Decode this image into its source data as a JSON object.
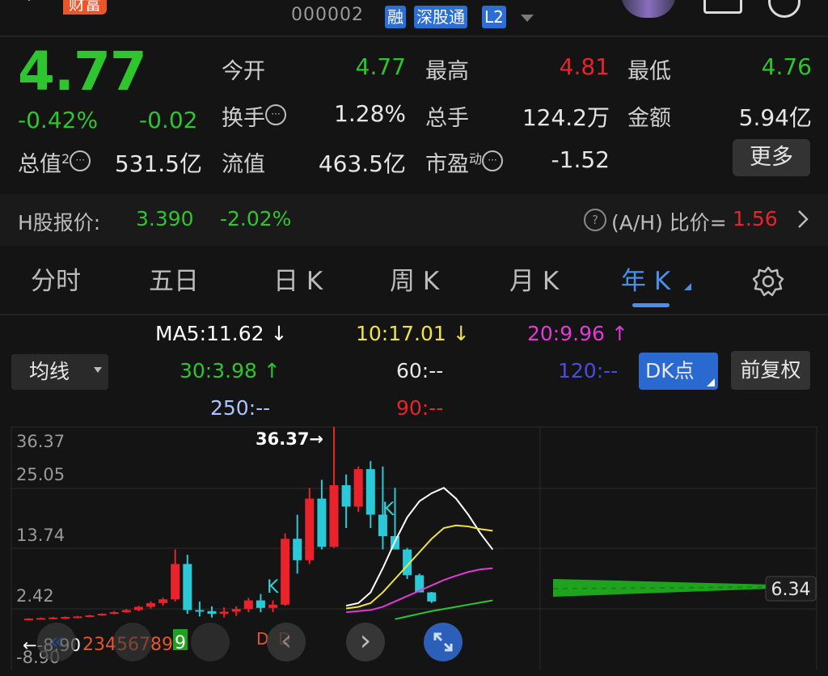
{
  "header": {
    "badge": "财富",
    "code": "000002",
    "tags": [
      "融",
      "深股通",
      "L2"
    ]
  },
  "quote": {
    "price": "4.77",
    "change_pct": "-0.42%",
    "change": "-0.02",
    "open_label": "今开",
    "open": "4.77",
    "high_label": "最高",
    "high": "4.81",
    "low_label": "最低",
    "low": "4.76",
    "turnover_label": "换手",
    "turnover": "1.28%",
    "volume_label": "总手",
    "volume": "124.2万",
    "amount_label": "金额",
    "amount": "5.94亿",
    "mktcap_label": "总值",
    "mktcap_sup": "2",
    "mktcap": "531.5亿",
    "float_label": "流值",
    "float": "463.5亿",
    "pe_label": "市盈",
    "pe_sup": "动",
    "pe": "-1.52",
    "more_label": "更多"
  },
  "hshare": {
    "label": "H股报价:",
    "price": "3.390",
    "change_pct": "-2.02%",
    "ratio_label": "(A/H) 比价=",
    "ratio": "1.56"
  },
  "tabs": [
    "分时",
    "五日",
    "日 K",
    "周 K",
    "月 K",
    "年 K"
  ],
  "active_tab_index": 5,
  "ma": {
    "ma5": "MA5:11.62 ↓",
    "ma10": "10:17.01 ↓",
    "ma20": "20:9.96 ↑",
    "ma30": "30:3.98 ↑",
    "ma60": "60:--",
    "ma120": "120:--",
    "ma250": "250:--",
    "ma90": "90:--",
    "line_select": "均线",
    "dk_label": "DK点",
    "fq_label": "前复权"
  },
  "chart_data": {
    "type": "candlestick",
    "y_tick_labels": [
      "36.37",
      "25.05",
      "13.74",
      "2.42",
      "-8.90"
    ],
    "max_marker": "36.37→",
    "min_marker": "←-8.90",
    "last_value_label": "6.34",
    "signal_labels": [
      "K",
      "K",
      "D",
      "D"
    ],
    "count_label": "23456789",
    "count_highlight": "9",
    "candles": [
      {
        "o": 0.5,
        "h": 0.7,
        "l": 0.4,
        "c": 0.6
      },
      {
        "o": 0.6,
        "h": 0.8,
        "l": 0.5,
        "c": 0.7
      },
      {
        "o": 0.7,
        "h": 0.9,
        "l": 0.6,
        "c": 0.8
      },
      {
        "o": 0.8,
        "h": 1.0,
        "l": 0.7,
        "c": 0.9
      },
      {
        "o": 0.9,
        "h": 1.1,
        "l": 0.8,
        "c": 1.0
      },
      {
        "o": 1.0,
        "h": 1.3,
        "l": 0.9,
        "c": 1.2
      },
      {
        "o": 1.2,
        "h": 1.6,
        "l": 1.1,
        "c": 1.5
      },
      {
        "o": 1.5,
        "h": 2.0,
        "l": 1.4,
        "c": 1.8
      },
      {
        "o": 1.8,
        "h": 2.4,
        "l": 1.7,
        "c": 2.2
      },
      {
        "o": 2.2,
        "h": 3.0,
        "l": 2.0,
        "c": 2.8
      },
      {
        "o": 2.8,
        "h": 3.8,
        "l": 2.5,
        "c": 3.5
      },
      {
        "o": 3.5,
        "h": 4.5,
        "l": 3.0,
        "c": 4.2
      },
      {
        "o": 4.2,
        "h": 13.5,
        "l": 3.8,
        "c": 10.8
      },
      {
        "o": 10.8,
        "h": 12.5,
        "l": 1.5,
        "c": 2.2
      },
      {
        "o": 2.2,
        "h": 3.8,
        "l": 1.0,
        "c": 2.0
      },
      {
        "o": 2.0,
        "h": 2.9,
        "l": 0.8,
        "c": 1.5
      },
      {
        "o": 1.5,
        "h": 2.7,
        "l": 0.8,
        "c": 1.9
      },
      {
        "o": 1.9,
        "h": 2.9,
        "l": 1.1,
        "c": 2.4
      },
      {
        "o": 2.4,
        "h": 4.5,
        "l": 1.8,
        "c": 4.0
      },
      {
        "o": 4.0,
        "h": 5.2,
        "l": 1.8,
        "c": 2.6
      },
      {
        "o": 2.6,
        "h": 4.0,
        "l": 1.8,
        "c": 3.2
      },
      {
        "o": 3.2,
        "h": 16.5,
        "l": 3.0,
        "c": 15.5
      },
      {
        "o": 15.5,
        "h": 20.0,
        "l": 9.0,
        "c": 11.5
      },
      {
        "o": 11.5,
        "h": 25.0,
        "l": 10.8,
        "c": 23.0
      },
      {
        "o": 23.0,
        "h": 26.5,
        "l": 13.5,
        "c": 14.0
      },
      {
        "o": 14.0,
        "h": 36.37,
        "l": 13.8,
        "c": 25.5
      },
      {
        "o": 25.5,
        "h": 27.5,
        "l": 17.5,
        "c": 21.5
      },
      {
        "o": 21.5,
        "h": 29.0,
        "l": 20.5,
        "c": 28.5
      },
      {
        "o": 28.5,
        "h": 30.0,
        "l": 17.5,
        "c": 20.0
      },
      {
        "o": 20.0,
        "h": 29.0,
        "l": 13.5,
        "c": 16.0
      },
      {
        "o": 16.0,
        "h": 25.0,
        "l": 13.5,
        "c": 13.5
      },
      {
        "o": 13.5,
        "h": 13.8,
        "l": 8.0,
        "c": 8.7
      },
      {
        "o": 8.7,
        "h": 9.0,
        "l": 5.5,
        "c": 5.5
      },
      {
        "o": 5.5,
        "h": 5.6,
        "l": 3.5,
        "c": 3.8
      }
    ],
    "ma_lines": {
      "ma5": {
        "color": "#ffffff",
        "start": 26,
        "values": [
          3.0,
          3.5,
          5.5,
          10.0,
          15.0,
          19.5,
          22.5,
          24.0,
          25.0,
          23.0,
          20.0,
          16.5,
          13.5
        ]
      },
      "ma10": {
        "color": "#f0e442",
        "start": 26,
        "values": [
          2.5,
          2.8,
          3.5,
          5.5,
          8.0,
          10.5,
          13.0,
          15.5,
          17.5,
          18.0,
          17.8,
          17.3,
          17.0
        ]
      },
      "ma20": {
        "color": "#e03ad8",
        "start": 26,
        "values": [
          1.8,
          2.0,
          2.2,
          2.8,
          3.8,
          4.8,
          5.8,
          6.8,
          7.8,
          8.6,
          9.3,
          9.8,
          10.0
        ]
      },
      "ma30": {
        "color": "#2ec52e",
        "start": 30,
        "values": [
          0.5,
          1.0,
          1.5,
          2.0,
          2.4,
          2.8,
          3.2,
          3.6,
          4.0
        ]
      }
    }
  },
  "controls": {
    "prev_icon": "«",
    "left_icon": "‹",
    "right_icon": "›"
  },
  "colors": {
    "up": "#e8232c",
    "down": "#2ec52e",
    "accent": "#2b6fd6",
    "active_tab": "#4a8fe8"
  }
}
